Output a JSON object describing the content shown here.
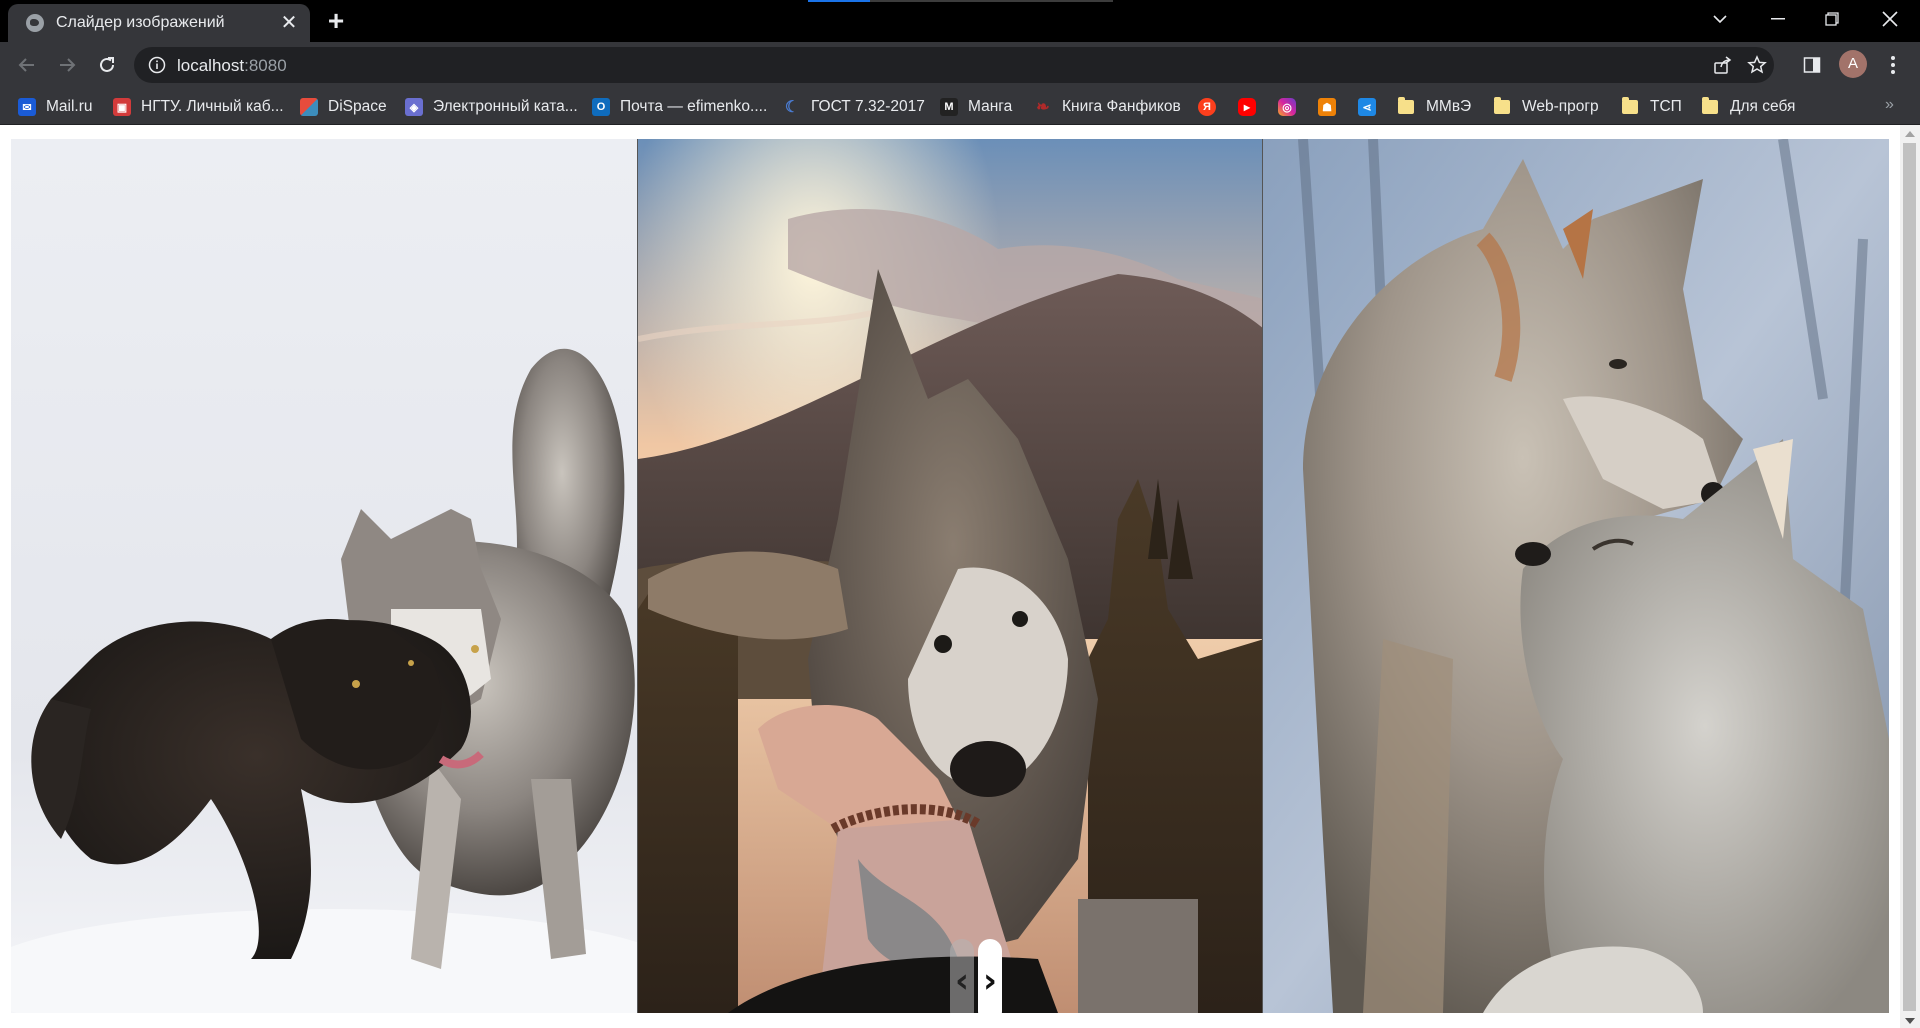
{
  "browser": {
    "tab_title": "Слайдер изображений",
    "new_tab_label": "+",
    "url_host": "localhost",
    "url_port": ":8080",
    "profile_initial": "A"
  },
  "bookmarks": [
    {
      "label": "Mail.ru",
      "icon": "mail-ru-icon",
      "color": "#1a5bd6"
    },
    {
      "label": "НГТУ. Личный каб...",
      "icon": "ngtu-icon",
      "color": "#d23b3b"
    },
    {
      "label": "DiSpace",
      "icon": "dispace-icon",
      "color": "#3c8dbc"
    },
    {
      "label": "Электронный ката...",
      "icon": "catalog-icon",
      "color": "#6a6fd0"
    },
    {
      "label": "Почта — efimenko....",
      "icon": "outlook-icon",
      "color": "#0f6cbd"
    },
    {
      "label": "ГОСТ 7.32-2017",
      "icon": "gost-icon",
      "color": "#4a7bd0"
    },
    {
      "label": "Манга",
      "icon": "manga-icon",
      "color": "#222222"
    },
    {
      "label": "Книга Фанфиков",
      "icon": "ficbook-icon",
      "color": "#8b1e1e"
    },
    {
      "label": "",
      "icon": "yandex-icon",
      "color": "#fc3f1d"
    },
    {
      "label": "",
      "icon": "youtube-icon",
      "color": "#ff0000"
    },
    {
      "label": "",
      "icon": "instagram-icon",
      "color": "#d6249f"
    },
    {
      "label": "",
      "icon": "ok-icon",
      "color": "#ee8208"
    },
    {
      "label": "",
      "icon": "share-icon",
      "color": "#1e88e5"
    },
    {
      "label": "ММвЭ",
      "icon": "folder-icon",
      "color": "#f7e08a"
    },
    {
      "label": "Web-прогр",
      "icon": "folder-icon",
      "color": "#f7e08a"
    },
    {
      "label": "ТСП",
      "icon": "folder-icon",
      "color": "#f7e08a"
    },
    {
      "label": "Для себя",
      "icon": "folder-icon",
      "color": "#f7e08a"
    }
  ],
  "slider": {
    "slides": [
      {
        "subject": "two wolves playing in snow"
      },
      {
        "subject": "dog head in hand at mountain sunset"
      },
      {
        "subject": "two grey wolves close together"
      }
    ],
    "prev_label": "‹",
    "next_label": "›"
  },
  "colors": {
    "accent": "#1a73e8",
    "chrome_dark": "#35363a",
    "frame": "#000000"
  }
}
